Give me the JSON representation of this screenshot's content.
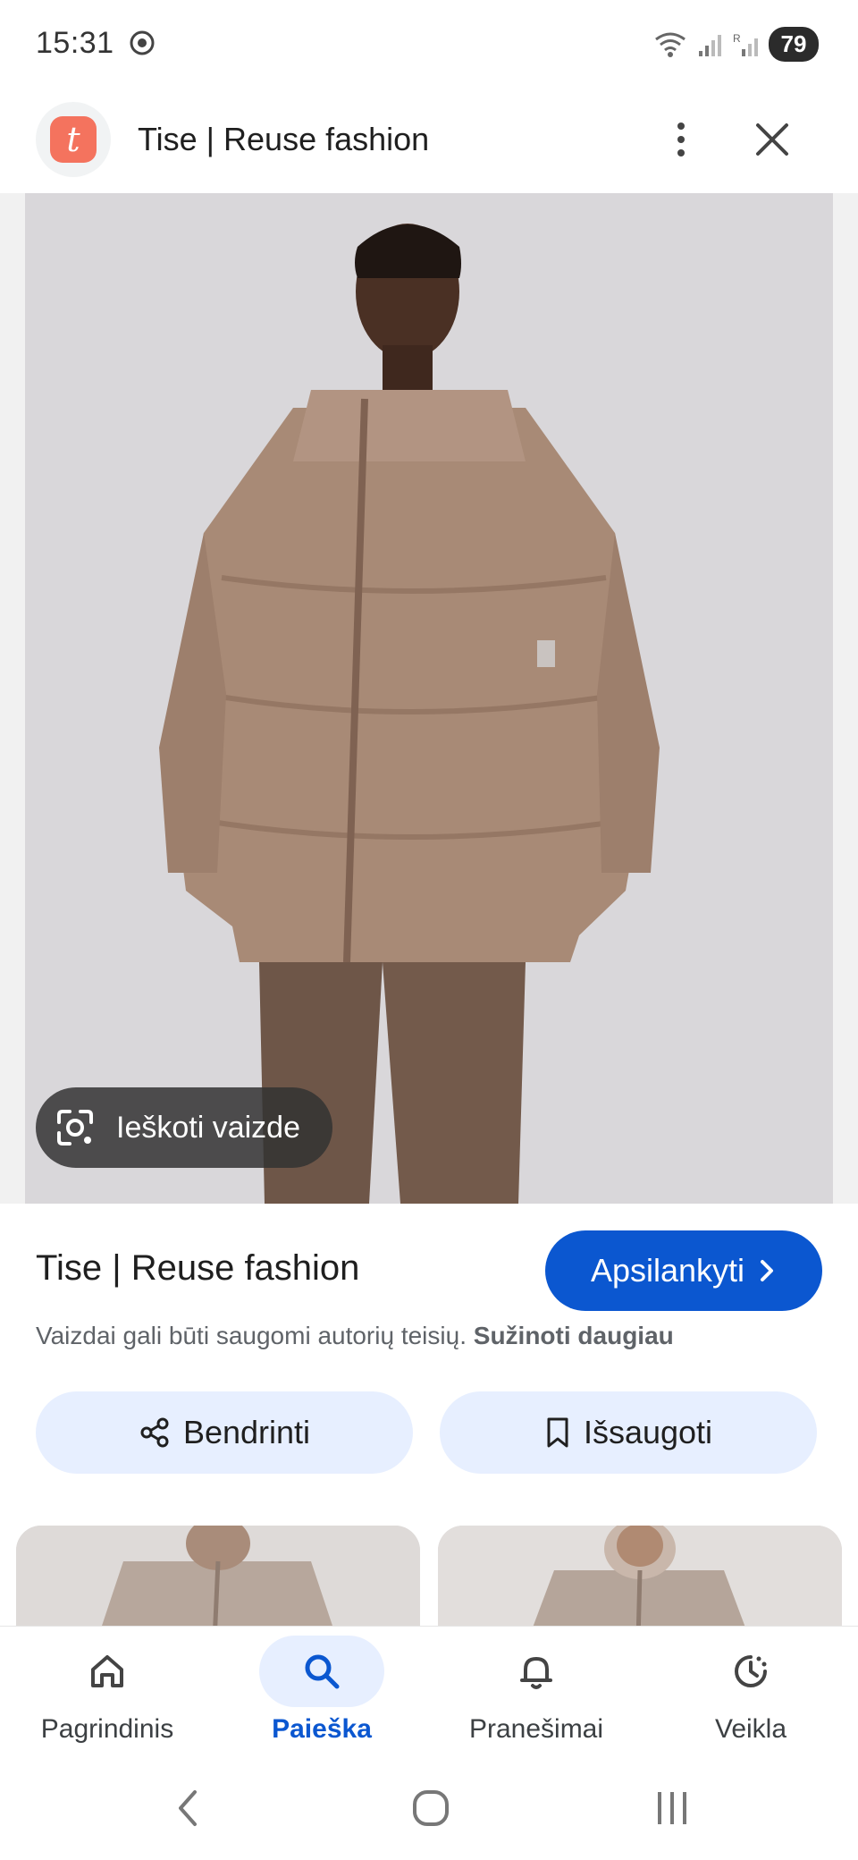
{
  "status_bar": {
    "time": "15:31",
    "battery": "79",
    "icons": [
      "chrome-icon",
      "wifi-icon",
      "signal-icon",
      "signal-roaming-icon",
      "battery-icon"
    ]
  },
  "header": {
    "site_logo_letter": "t",
    "title": "Tise | Reuse fashion",
    "icons": [
      "more-vert-icon",
      "close-icon"
    ]
  },
  "image": {
    "lens_label": "Ieškoti vaizde"
  },
  "info": {
    "title": "Tise | Reuse fashion",
    "visit_label": "Apsilankyti",
    "copyright_text": "Vaizdai gali būti saugomi autorių teisių.",
    "learn_more": "Sužinoti daugiau",
    "share_label": "Bendrinti",
    "save_label": "Išsaugoti"
  },
  "bottom_nav": {
    "items": [
      {
        "label": "Pagrindinis",
        "icon": "home-icon",
        "active": false
      },
      {
        "label": "Paieška",
        "icon": "search-icon",
        "active": true
      },
      {
        "label": "Pranešimai",
        "icon": "bell-icon",
        "active": false
      },
      {
        "label": "Veikla",
        "icon": "activity-icon",
        "active": false
      }
    ]
  },
  "colors": {
    "accent": "#0b57d0",
    "chip_bg": "#e7efff",
    "logo": "#f4735e"
  }
}
